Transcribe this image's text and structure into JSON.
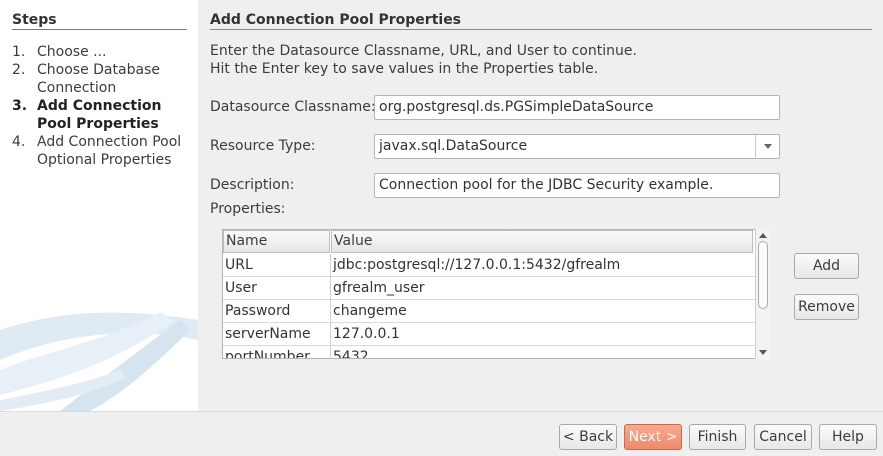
{
  "steps": {
    "heading": "Steps",
    "items": [
      {
        "num": "1.",
        "label": "Choose ..."
      },
      {
        "num": "2.",
        "label": "Choose Database",
        "label2": "Connection"
      },
      {
        "num": "3.",
        "label": "Add Connection",
        "label2": "Pool Properties",
        "current": true
      },
      {
        "num": "4.",
        "label": "Add Connection Pool",
        "label2": "Optional Properties"
      }
    ]
  },
  "panel": {
    "title": "Add Connection Pool Properties",
    "instruction1": "Enter the Datasource Classname, URL, and User to continue.",
    "instruction2": "Hit the Enter key to save values in the Properties table."
  },
  "form": {
    "datasource_label": "Datasource Classname:",
    "datasource_value": "org.postgresql.ds.PGSimpleDataSource",
    "resource_type_label": "Resource Type:",
    "resource_type_value": "javax.sql.DataSource",
    "description_label": "Description:",
    "description_value": "Connection pool for the JDBC Security example.",
    "properties_label": "Properties:"
  },
  "properties_table": {
    "columns": [
      "Name",
      "Value"
    ],
    "rows": [
      {
        "name": "URL",
        "value": "jdbc:postgresql://127.0.0.1:5432/gfrealm"
      },
      {
        "name": "User",
        "value": "gfrealm_user"
      },
      {
        "name": "Password",
        "value": "changeme"
      },
      {
        "name": "serverName",
        "value": "127.0.0.1"
      },
      {
        "name": "portNumber",
        "value": "5432"
      }
    ]
  },
  "side_buttons": {
    "add": "Add",
    "remove": "Remove"
  },
  "nav_buttons": {
    "back": "< Back",
    "next": "Next >",
    "finish": "Finish",
    "cancel": "Cancel",
    "help": "Help"
  },
  "colors": {
    "primary_button": "#f08a6a",
    "left_panel": "#ffffff",
    "background": "#efefef"
  }
}
